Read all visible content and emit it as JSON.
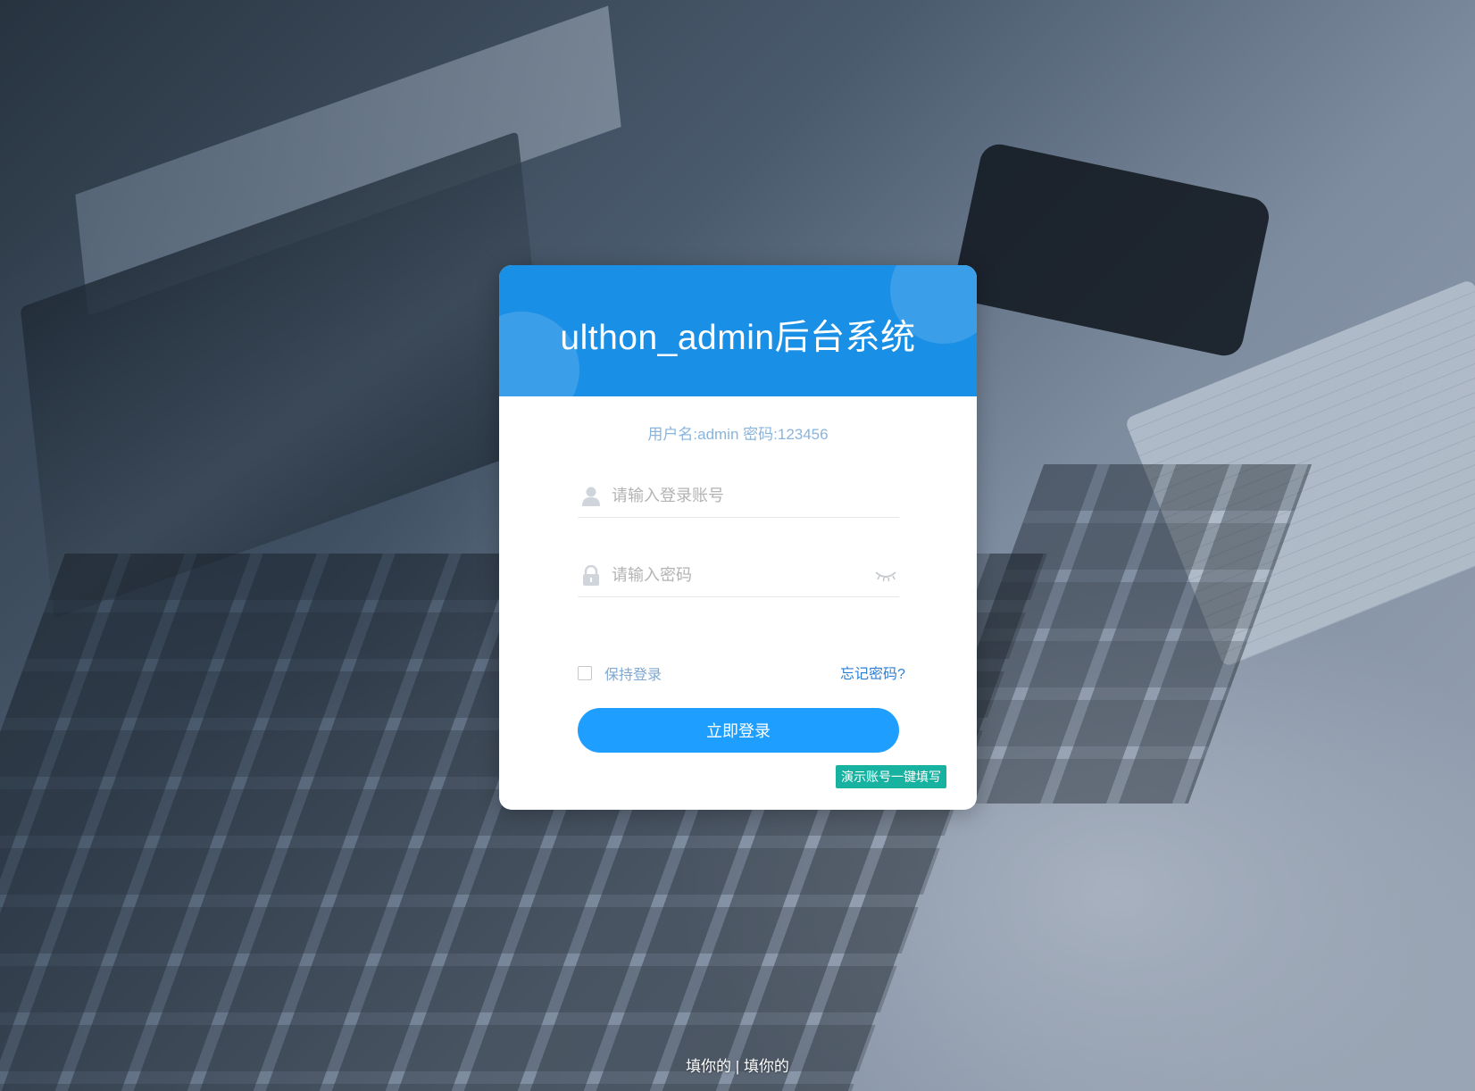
{
  "page": {
    "title": "ulthon_admin后台系统",
    "hint": "用户名:admin 密码:123456"
  },
  "login_form": {
    "username_placeholder": "请输入登录账号",
    "username_value": "",
    "password_placeholder": "请输入密码",
    "password_value": "",
    "remember_label": "保持登录",
    "remember_checked": false,
    "forgot_label": "忘记密码?",
    "submit_label": "立即登录",
    "demo_fill_label": "演示账号一键填写"
  },
  "footer": {
    "left_text": "填你的",
    "separator": " | ",
    "right_link": "填你的"
  },
  "colors": {
    "header_bg": "#1a8fe6",
    "primary_button": "#1e9fff",
    "demo_button": "#17b3a0",
    "hint_text": "#8ab4dc",
    "link": "#2f7fd1"
  },
  "icons": {
    "username": "user-icon",
    "password": "lock-icon",
    "toggle_password": "eye-closed-icon"
  }
}
